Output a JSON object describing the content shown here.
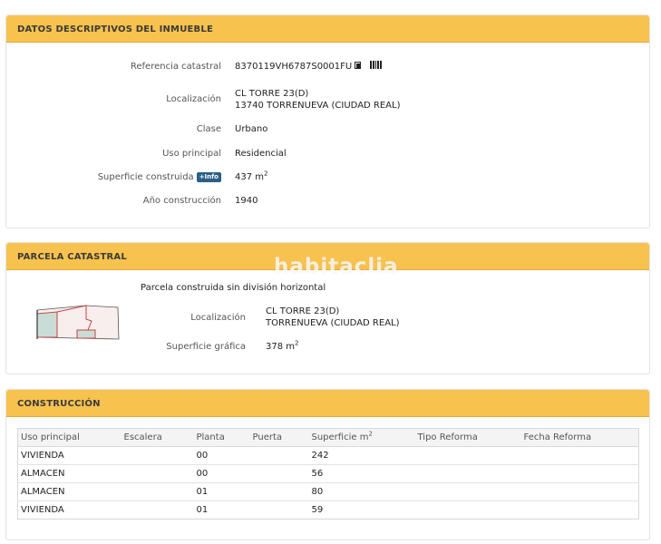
{
  "datos": {
    "title": "DATOS DESCRIPTIVOS DEL INMUEBLE",
    "rows": {
      "referencia": {
        "label": "Referencia catastral",
        "value": "8370119VH6787S0001FU"
      },
      "localizacion": {
        "label": "Localización",
        "line1": "CL TORRE 23(D)",
        "line2": "13740 TORRENUEVA (CIUDAD REAL)"
      },
      "clase": {
        "label": "Clase",
        "value": "Urbano"
      },
      "uso": {
        "label": "Uso principal",
        "value": "Residencial"
      },
      "superficie": {
        "label": "Superficie construida",
        "badge": "+Info",
        "value": "437 m",
        "unit_sup": "2"
      },
      "anio": {
        "label": "Año construcción",
        "value": "1940"
      }
    },
    "icons": [
      "copy-icon",
      "barcode-icon"
    ]
  },
  "parcela": {
    "title": "PARCELA CATASTRAL",
    "subtitle": "Parcela construida sin división horizontal",
    "localizacion": {
      "label": "Localización",
      "line1": "CL TORRE 23(D)",
      "line2": "TORRENUEVA (CIUDAD REAL)"
    },
    "superficie": {
      "label": "Superficie gráfica",
      "value": "378 m",
      "unit_sup": "2"
    }
  },
  "construccion": {
    "title": "CONSTRUCCIÓN",
    "headers": [
      "Uso principal",
      "Escalera",
      "Planta",
      "Puerta",
      "Superficie m",
      "Tipo Reforma",
      "Fecha Reforma"
    ],
    "header_sup": "2",
    "rows": [
      [
        "VIVIENDA",
        "",
        "00",
        "",
        "242",
        "",
        ""
      ],
      [
        "ALMACEN",
        "",
        "00",
        "",
        "56",
        "",
        ""
      ],
      [
        "ALMACEN",
        "",
        "01",
        "",
        "80",
        "",
        ""
      ],
      [
        "VIVIENDA",
        "",
        "01",
        "",
        "59",
        "",
        ""
      ]
    ]
  },
  "watermark": "habitaclia",
  "colors": {
    "header_bg": "#f7c24e",
    "badge_bg": "#2b5f86",
    "plot_fill": "#f9eeee",
    "plot_building": "#c9ddd6",
    "plot_line": "#c44444"
  }
}
